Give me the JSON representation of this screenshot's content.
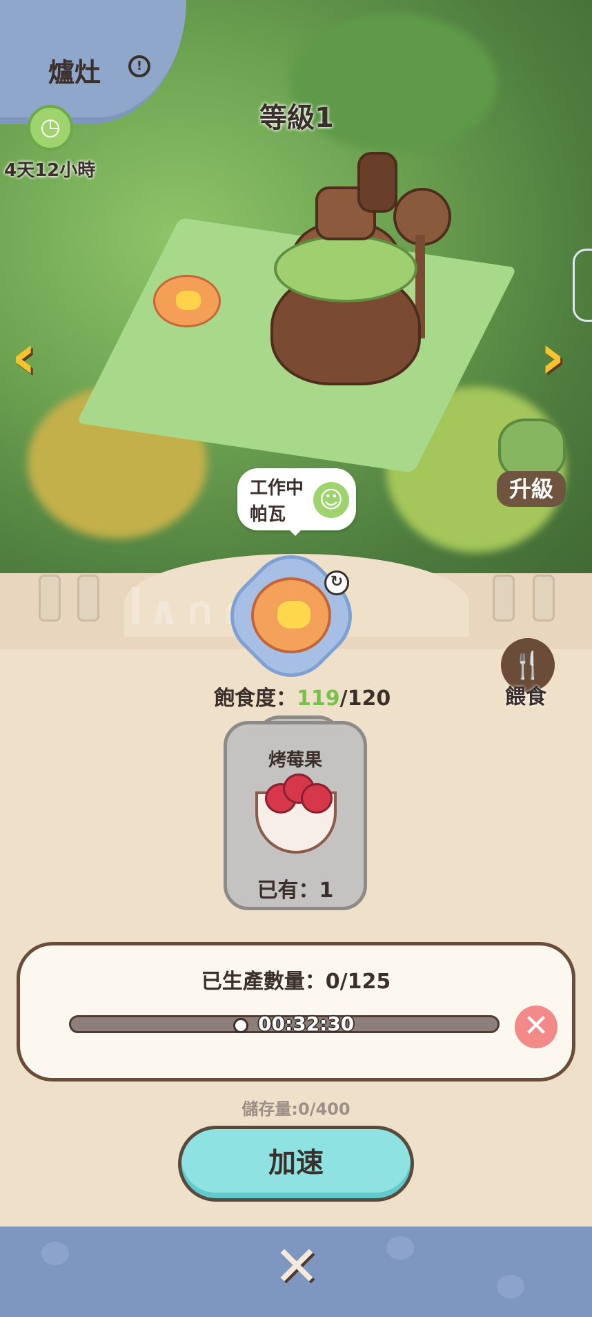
{
  "header": {
    "title": "爐灶",
    "timer": "4天12小時",
    "level": "等級1"
  },
  "scene": {
    "status_line1": "工作中",
    "status_line2": "帕瓦",
    "upgrade_label": "升級"
  },
  "pal": {
    "satiety_label": "飽食度：",
    "satiety_current": "119",
    "satiety_max": "/120",
    "feed_label": "餵食"
  },
  "item": {
    "name": "烤莓果",
    "owned": "已有：1"
  },
  "production": {
    "title": "已生產數量：0/125",
    "time": "00:32:30",
    "progress": 0.45,
    "storage": "儲存量:0/400"
  },
  "actions": {
    "speed_up": "加速"
  },
  "colors": {
    "accent_green": "#77c04a",
    "speed_button": "#8ee2e2",
    "cancel_button": "#f38a8a",
    "frame_blue": "#7e97c0"
  },
  "icons": [
    "info-icon",
    "timer-icon",
    "arrow-left-icon",
    "arrow-right-icon",
    "smile-icon",
    "upgrade-icon",
    "refresh-icon",
    "fork-spoon-icon",
    "clock-icon",
    "cancel-icon",
    "close-icon"
  ]
}
